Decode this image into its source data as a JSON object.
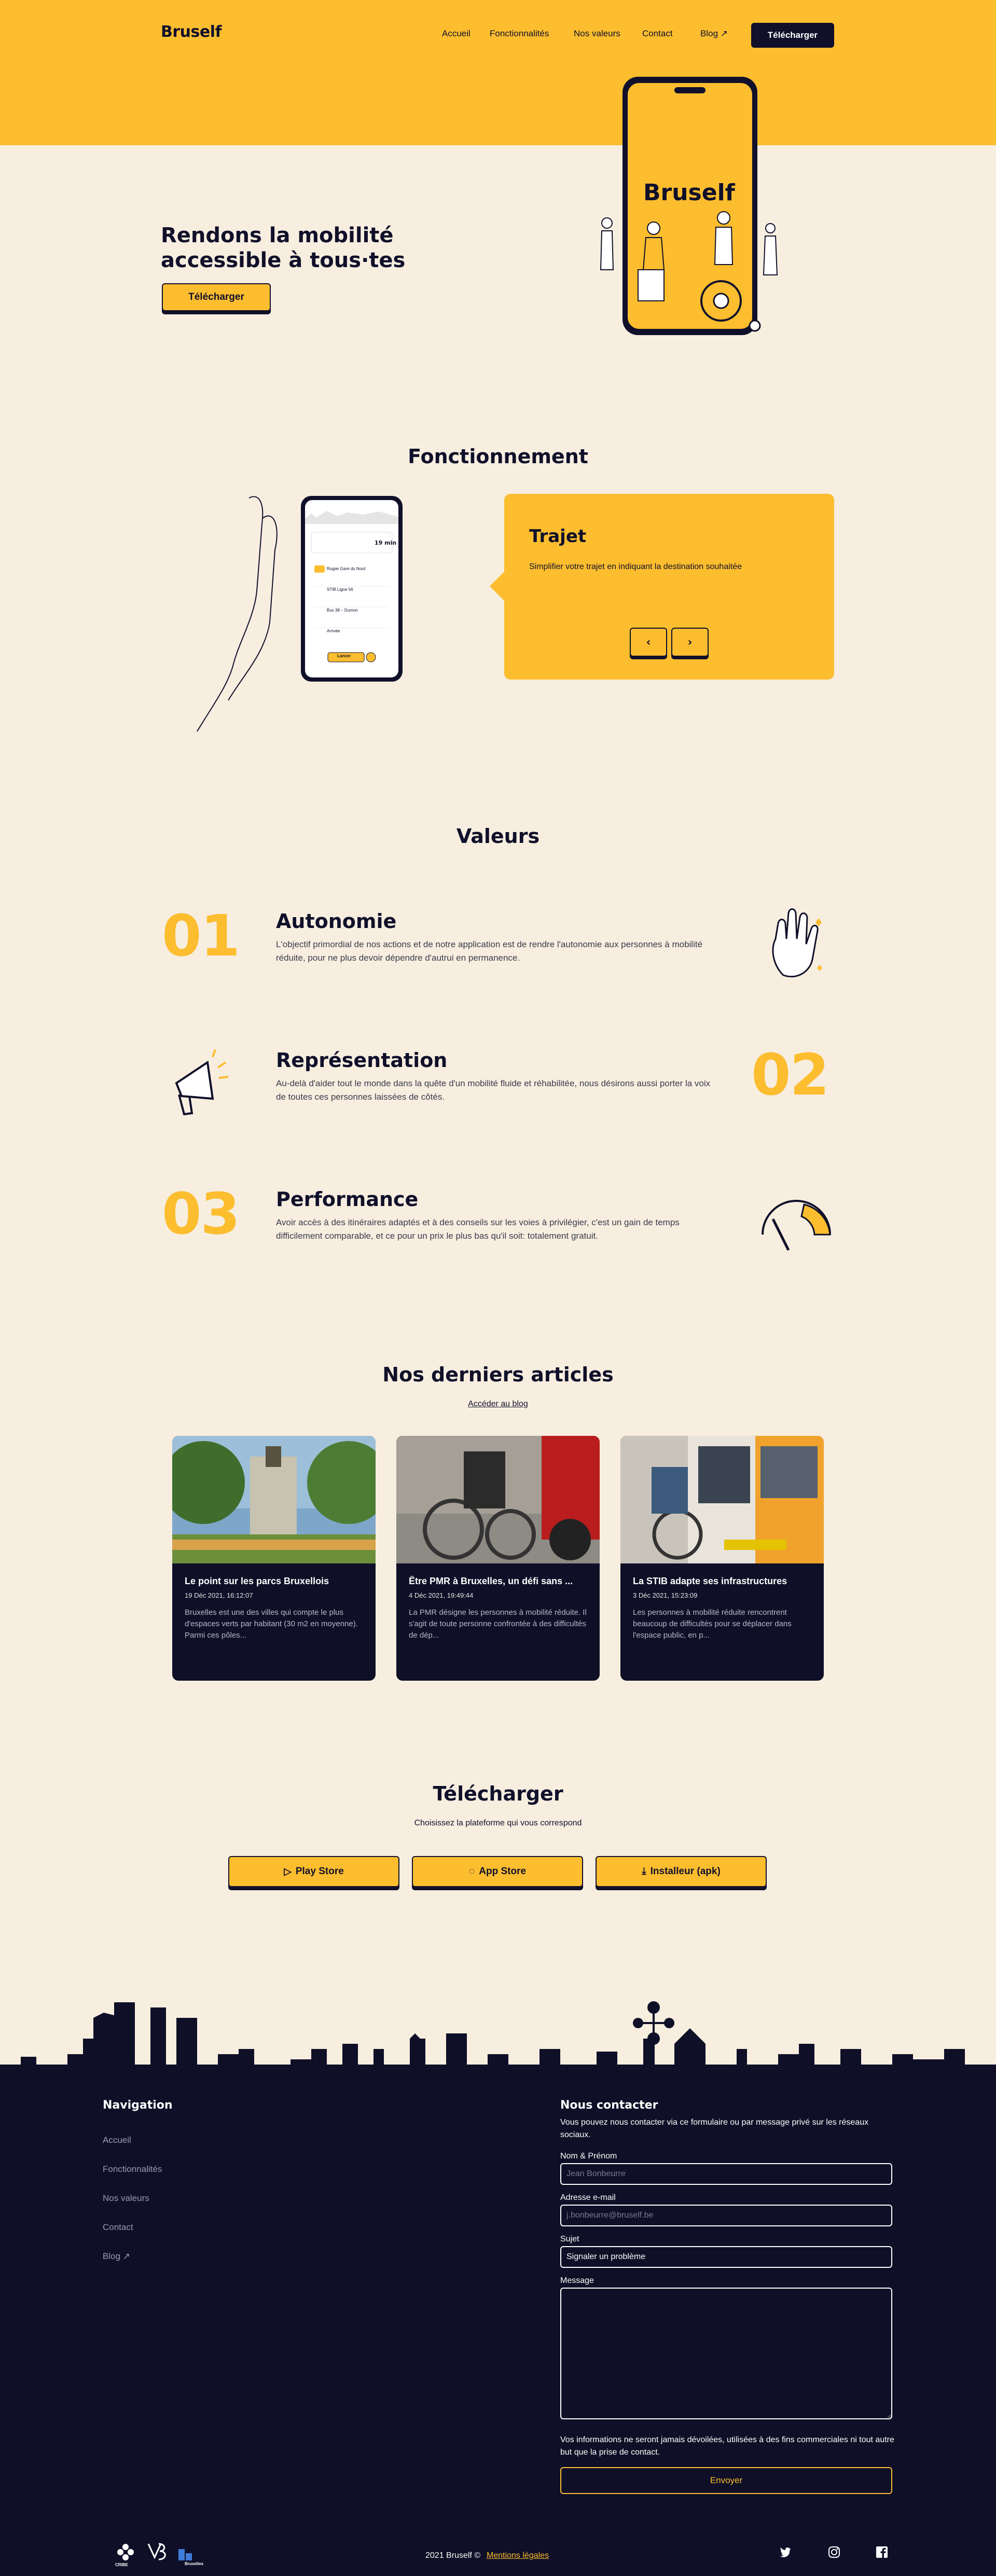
{
  "header": {
    "logo": "Bruself",
    "nav": [
      "Accueil",
      "Fonctionnalités",
      "Nos valeurs",
      "Contact",
      "Blog ↗"
    ],
    "cta": "Télécharger"
  },
  "hero": {
    "title": "Rendons la mobilité accessible à tous·tes",
    "cta": "Télécharger",
    "phone_brand": "Bruself"
  },
  "features": {
    "title": "Fonctionnement",
    "card_title": "Trajet",
    "card_text": "Simplifier votre trajet en indiquant la destination souhaitée",
    "prev": "‹",
    "next": "›",
    "phone_time": "19 min",
    "phone_button": "Lancer",
    "phone_list": [
      "Rogier Gare du Nord",
      "STIB Ligne 56",
      "Bus 38 – Dumon",
      "Arrivée"
    ]
  },
  "values": {
    "title": "Valeurs",
    "items": [
      {
        "num": "01",
        "title": "Autonomie",
        "text": "L'objectif primordial de nos actions et de notre application est de rendre l'autonomie aux personnes à mobilité réduite, pour ne plus devoir dépendre d'autrui en permanence."
      },
      {
        "num": "02",
        "title": "Représentation",
        "text": "Au-delà d'aider tout le monde dans la quête d'un mobilité fluide et réhabilitée, nous désirons aussi porter la voix de toutes ces personnes laissées de côtés."
      },
      {
        "num": "03",
        "title": "Performance",
        "text": "Avoir accès à des itinéraires adaptés et à des conseils sur les voies à privilégier, c'est un gain de temps difficilement comparable, et ce pour un prix le plus bas qu'il soit: totalement gratuit."
      }
    ]
  },
  "articles": {
    "title": "Nos derniers articles",
    "link": "Accéder au blog",
    "items": [
      {
        "title": "Le point sur les parcs Bruxellois",
        "date": "19 Déc 2021, 16:12:07",
        "excerpt": "Bruxelles est une des villes qui compte le plus d'espaces verts par habitant (30 m2 en moyenne). Parmi ces pôles..."
      },
      {
        "title": "Être PMR à Bruxelles, un défi sans ...",
        "date": "4 Déc 2021, 19:49:44",
        "excerpt": "La PMR désigne les personnes à mobilité réduite. Il s'agit de toute personne confrontée à des difficultés de dép..."
      },
      {
        "title": "La STIB adapte ses infrastructures",
        "date": "3 Déc 2021, 15:23:09",
        "excerpt": "Les personnes à mobilité réduite rencontrent beaucoup de difficultés pour se déplacer dans l'espace public, en p..."
      }
    ]
  },
  "download": {
    "title": "Télécharger",
    "subtitle": "Choisissez la plateforme qui vous correspond",
    "buttons": [
      "Play Store",
      "App Store",
      "Installeur (apk)"
    ]
  },
  "footer": {
    "nav_title": "Navigation",
    "nav": [
      "Accueil",
      "Fonctionnalités",
      "Nos valeurs",
      "Contact",
      "Blog ↗"
    ],
    "contact_title": "Nous contacter",
    "contact_intro": "Vous pouvez nous contacter via ce formulaire ou par message privé sur les réseaux sociaux.",
    "name_label": "Nom & Prénom",
    "name_placeholder": "Jean Bonbeurre",
    "email_label": "Adresse e-mail",
    "email_placeholder": "j.bonbeurre@bruself.be",
    "subject_label": "Sujet",
    "subject_value": "Signaler un problème",
    "message_label": "Message",
    "privacy": "Vos informations ne seront jamais dévoilées, utilisées à des fins commerciales ni tout autre but que la prise de contact.",
    "submit": "Envoyer",
    "copyright": "2021 Bruself ©",
    "legal": "Mentions légales",
    "partners": [
      "CRIBE",
      "Bruxelles"
    ]
  },
  "colors": {
    "yellow": "#fcbd2f",
    "navy": "#0f0f27",
    "cream": "#f7eee0"
  }
}
